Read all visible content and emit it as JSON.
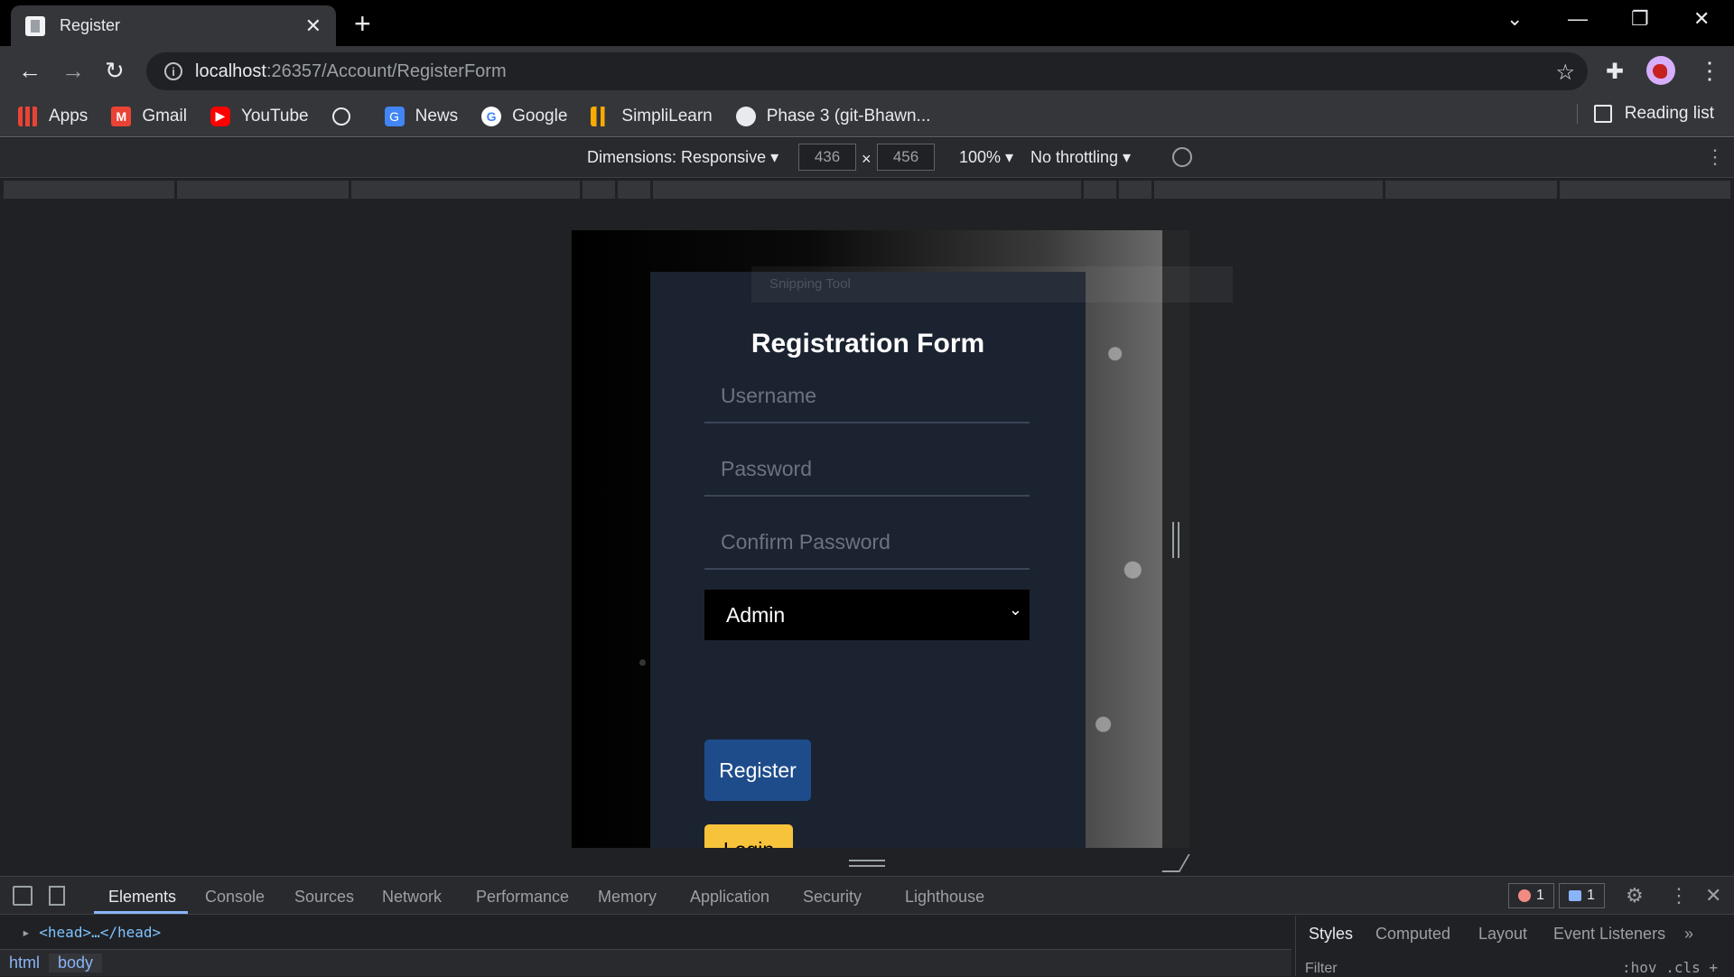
{
  "browser": {
    "tab_title": "Register",
    "url_host": "localhost",
    "url_path": ":26357/Account/RegisterForm",
    "bookmarks": [
      {
        "label": "Apps",
        "icon": "apps-icon"
      },
      {
        "label": "Gmail",
        "icon": "gmail-icon"
      },
      {
        "label": "YouTube",
        "icon": "youtube-icon"
      },
      {
        "label": "",
        "icon": "globe-icon"
      },
      {
        "label": "News",
        "icon": "news-icon"
      },
      {
        "label": "Google",
        "icon": "google-icon"
      },
      {
        "label": "SimpliLearn",
        "icon": "simplilearn-icon"
      },
      {
        "label": "Phase 3 (git-Bhawn...",
        "icon": "github-icon"
      }
    ],
    "reading_list": "Reading list"
  },
  "device_toolbar": {
    "dimensions": "Dimensions: Responsive ▾",
    "width": "436",
    "height": "456",
    "times": "×",
    "zoom": "100% ▾",
    "throttling": "No throttling ▾"
  },
  "page": {
    "ghost_overlay": "Snipping Tool",
    "form_title": "Registration Form",
    "username_placeholder": "Username",
    "password_placeholder": "Password",
    "confirm_placeholder": "Confirm Password",
    "role_selected": "Admin",
    "register_label": "Register",
    "login_label": "Login"
  },
  "devtools": {
    "tabs": [
      "Elements",
      "Console",
      "Sources",
      "Network",
      "Performance",
      "Memory",
      "Application",
      "Security",
      "Lighthouse"
    ],
    "errors": "1",
    "messages": "1",
    "dom_line": "<head>…</head>",
    "breadcrumbs": [
      "html",
      "body"
    ],
    "side_tabs": [
      "Styles",
      "Computed",
      "Layout",
      "Event Listeners",
      "»"
    ],
    "filter_placeholder": "Filter",
    "style_tools": ":hov .cls +"
  },
  "colors": {
    "register_button": "#1e4c8b",
    "login_button": "#f6c33b",
    "card_bg": "#1c2330"
  }
}
